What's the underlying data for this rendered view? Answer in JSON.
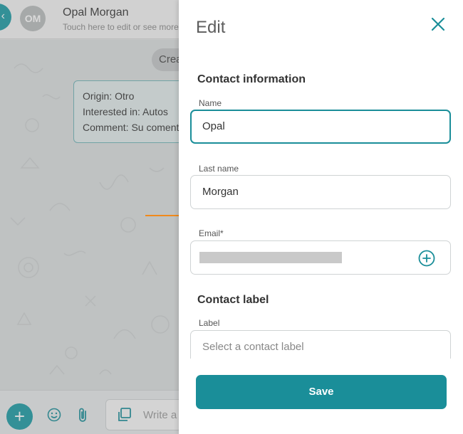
{
  "chat": {
    "avatar_initials": "OM",
    "contact_name": "Opal Morgan",
    "contact_subtitle": "Touch here to edit or see more",
    "create_pill": "Crea",
    "message": {
      "origin": "Origin: Otro",
      "interested": "Interested in: Autos",
      "comment": "Comment: Su comentario"
    },
    "input_placeholder": "Write a"
  },
  "drawer": {
    "title": "Edit",
    "contact_section": "Contact information",
    "name_label": "Name",
    "name_value": "Opal",
    "last_name_label": "Last name",
    "last_name_value": "Morgan",
    "email_label": "Email*",
    "label_section": "Contact label",
    "label_label": "Label",
    "label_placeholder": "Select a contact label",
    "save_label": "Save"
  },
  "colors": {
    "accent": "#1a8e99",
    "arrow": "#f08a1c"
  },
  "icons": [
    "close-icon",
    "plus-circle-icon",
    "add-icon",
    "emoji-icon",
    "paperclip-icon",
    "copy-icon"
  ]
}
